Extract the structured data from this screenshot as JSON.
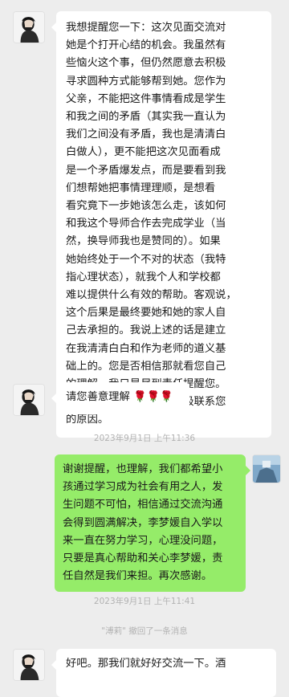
{
  "messages": [
    {
      "side": "left",
      "lines": [
        "我想提醒您一下：这次见面交流对",
        "她是个打开心结的机会。我虽然有",
        "些恼火这个事，但仍然愿意去积极",
        "寻求圆种方式能够帮到她。您作为",
        "父亲，不能把这件事情看成是学生",
        "和我之间的矛盾（其实我一直认为",
        "我们之间没有矛盾，我也是清清白",
        "白做人），更不能把这次见面看成",
        "是一个矛盾爆发点，而是要看到我",
        "们想帮她把事情理理顺，是想看",
        "看究竟下一步她该怎么走，该如何",
        "和我这个导师合作去完成学业（当",
        "然，换导师我也是赞同的）。如果",
        "她始终处于一个不对的状态（我特",
        "指心理状态），就我个人和学校都",
        "难以提供什么有效的帮助。客观说，",
        "这个后果是最终要她和她的家人自",
        "己去承担的。我说上述的话是建立",
        "在我清清白白和作为老师的道义基",
        "础上的。您是否相信那就看您自己",
        "的理解，我只是尽到责任提醒您。",
        "知儿莫如父，这也是我积极联系您",
        "的原因。"
      ]
    },
    {
      "side": "left",
      "lines": [
        "请您善意理解"
      ],
      "emoji": "🌹🌹🌹"
    },
    {
      "timestamp": "2023年9月1日 上午11:36"
    },
    {
      "side": "right",
      "lines": [
        "谢谢提醒，也理解，我们都希望小",
        "孩通过学习成为社会有用之人，发",
        "生问题不可怕，相信通过交流沟通",
        "会得到圆满解决，李梦媛自入学以",
        "来一直在努力学习，心理没问题，",
        "只要是真心帮助和关心李梦媛，责",
        "任自然是我们来担。再次感谢。"
      ]
    },
    {
      "timestamp": "2023年9月1日 上午11:41"
    },
    {
      "system": "\"溥莉\" 撤回了一条消息"
    },
    {
      "side": "left",
      "lines": [
        "好吧。那我们就好好交流一下。酒"
      ]
    }
  ],
  "icons": {
    "left_avatar": "teacher-avatar-icon",
    "right_avatar": "father-avatar-icon"
  },
  "colors": {
    "background": "#ededed",
    "left_bubble": "#ffffff",
    "right_bubble": "#95ec69",
    "timestamp": "#b2b2b2"
  }
}
